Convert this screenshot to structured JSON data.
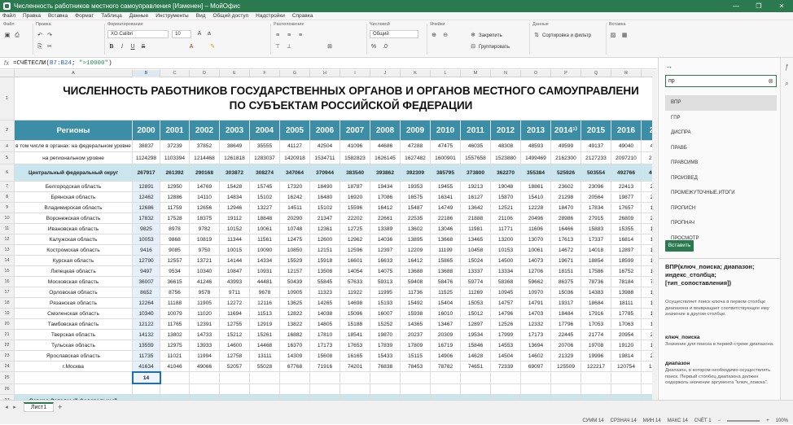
{
  "window": {
    "title": "Численность работников местного самоуправления [Изменен] – МойОфис",
    "controls": [
      "—",
      "❐",
      "✕"
    ]
  },
  "menu": [
    "Файл",
    "Правка",
    "Вставка",
    "Формат",
    "Таблица",
    "Данные",
    "Инструменты",
    "Вид",
    "Общий доступ",
    "Надстройки",
    "Справка"
  ],
  "ribbon": {
    "groups": [
      "Файл",
      "Правка",
      "Форматирование",
      "Расположение",
      "Числовой",
      "Ячейки",
      "Данные",
      "Вставка"
    ],
    "font_name": "XO Calibri",
    "font_size": "10",
    "number_format": "Общий",
    "freeze_label": "Закрепить",
    "group_label": "Группировать",
    "sort_label": "Сортировка и фильтр"
  },
  "formula_bar": {
    "fx": "fx",
    "prefix": "=СЧЁТЕСЛИ(",
    "range": "B7:B24",
    "sep": "; ",
    "criterion": "\">10000\"",
    "suffix": ")"
  },
  "columns": [
    "A",
    "B",
    "C",
    "D",
    "E",
    "F",
    "G",
    "H",
    "I",
    "J",
    "K",
    "L",
    "M",
    "N",
    "O",
    "P",
    "Q",
    "R",
    "S",
    "T"
  ],
  "sheet_title": {
    "line1": "ЧИСЛЕННОСТЬ РАБОТНИКОВ ГОСУДАРСТВЕННЫХ ОРГАНОВ И ОРГАНОВ МЕСТНОГО САМОУПРАВЛЕНИ",
    "line2": "ПО СУБЪЕКТАМ РОССИЙСКОЙ ФЕДЕРАЦИИ"
  },
  "header_row": {
    "label": "Регионы",
    "years": [
      "2000",
      "2001",
      "2002",
      "2003",
      "2004",
      "2005",
      "2006",
      "2007",
      "2008",
      "2009",
      "2010",
      "2011",
      "2012",
      "2013",
      "2014¹⁾",
      "2015",
      "2016",
      "201"
    ]
  },
  "rows": [
    {
      "rn": "4",
      "label": "в том числе в органах:\nна федеральном уровне",
      "vals": [
        "38837",
        "37239",
        "37852",
        "38649",
        "35555",
        "41127",
        "42504",
        "41096",
        "44686",
        "47288",
        "47475",
        "46035",
        "48308",
        "48593",
        "49599",
        "49137",
        "49040",
        "4967"
      ]
    },
    {
      "rn": "5",
      "label": "на региональном уровне",
      "vals": [
        "1124298",
        "1103394",
        "1214468",
        "1261818",
        "1283037",
        "1420918",
        "1534711",
        "1582823",
        "1626145",
        "1627482",
        "1600901",
        "1557658",
        "1523880",
        "1499469",
        "2162300",
        "2127233",
        "2097210",
        "21233"
      ]
    },
    {
      "rn": "6",
      "label": "Центральный федеральный округ",
      "fed": true,
      "vals": [
        "267917",
        "261392",
        "290168",
        "303872",
        "308274",
        "347064",
        "370944",
        "383540",
        "393862",
        "392309",
        "385795",
        "373800",
        "362270",
        "355384",
        "525926",
        "503554",
        "492766",
        "49153"
      ]
    },
    {
      "rn": "7",
      "label": "Белгородская область",
      "vals": [
        "12891",
        "12950",
        "14769",
        "15428",
        "15745",
        "17320",
        "18490",
        "18787",
        "19434",
        "19353",
        "19455",
        "19213",
        "19048",
        "18861",
        "23602",
        "23096",
        "22413",
        "2223"
      ]
    },
    {
      "rn": "8",
      "label": "Брянская область",
      "vals": [
        "12462",
        "12886",
        "14110",
        "14834",
        "15102",
        "16242",
        "16480",
        "16920",
        "17086",
        "16575",
        "16341",
        "16127",
        "15870",
        "15410",
        "21298",
        "20564",
        "19877",
        "2033"
      ]
    },
    {
      "rn": "9",
      "label": "Владимирская область",
      "vals": [
        "12686",
        "11759",
        "12656",
        "12946",
        "13227",
        "14511",
        "15102",
        "15596",
        "16412",
        "15487",
        "14749",
        "13642",
        "12521",
        "12228",
        "18470",
        "17834",
        "17657",
        "1786"
      ]
    },
    {
      "rn": "10",
      "label": "Воронежская область",
      "vals": [
        "17832",
        "17528",
        "18375",
        "19112",
        "18848",
        "20290",
        "21347",
        "22202",
        "22661",
        "22535",
        "22186",
        "21888",
        "21106",
        "20496",
        "28986",
        "27915",
        "26809",
        "2714"
      ]
    },
    {
      "rn": "11",
      "label": "Ивановская область",
      "vals": [
        "9825",
        "8978",
        "9782",
        "10152",
        "10061",
        "10748",
        "12361",
        "12725",
        "13389",
        "13602",
        "13046",
        "11981",
        "11771",
        "11606",
        "16466",
        "15883",
        "15355",
        "1525"
      ]
    },
    {
      "rn": "12",
      "label": "Калужская область",
      "vals": [
        "10053",
        "9868",
        "10819",
        "11344",
        "11561",
        "12475",
        "12600",
        "12962",
        "14036",
        "13895",
        "13668",
        "13465",
        "13200",
        "13070",
        "17613",
        "17337",
        "16814",
        "1725"
      ]
    },
    {
      "rn": "13",
      "label": "Костромская область",
      "vals": [
        "9416",
        "9085",
        "9750",
        "10015",
        "10090",
        "10850",
        "12151",
        "12596",
        "12397",
        "12209",
        "11199",
        "10458",
        "10153",
        "10061",
        "14672",
        "14018",
        "12897",
        "1308"
      ]
    },
    {
      "rn": "14",
      "label": "Курская область",
      "vals": [
        "12790",
        "12557",
        "13721",
        "14144",
        "14334",
        "15529",
        "15918",
        "16601",
        "16633",
        "16412",
        "15865",
        "15024",
        "14500",
        "14073",
        "19671",
        "18854",
        "18599",
        "1850"
      ]
    },
    {
      "rn": "15",
      "label": "Липецкая область",
      "vals": [
        "9497",
        "9534",
        "10340",
        "10847",
        "10931",
        "12157",
        "13508",
        "14054",
        "14075",
        "13688",
        "13688",
        "13337",
        "13334",
        "12706",
        "18151",
        "17586",
        "16752",
        "1721"
      ]
    },
    {
      "rn": "16",
      "label": "Московская область",
      "vals": [
        "36007",
        "36615",
        "41246",
        "43993",
        "44481",
        "50439",
        "55845",
        "57633",
        "59313",
        "59408",
        "58476",
        "59774",
        "58368",
        "59662",
        "86375",
        "78736",
        "78184",
        "7754"
      ]
    },
    {
      "rn": "17",
      "label": "Орловская область",
      "vals": [
        "8652",
        "8756",
        "9578",
        "9711",
        "9678",
        "10905",
        "11323",
        "11922",
        "11995",
        "11736",
        "11525",
        "11269",
        "10945",
        "10970",
        "15036",
        "14383",
        "13988",
        "1394"
      ]
    },
    {
      "rn": "18",
      "label": "Рязанская область",
      "vals": [
        "12264",
        "11188",
        "11905",
        "12272",
        "12116",
        "13625",
        "14265",
        "14698",
        "15193",
        "15492",
        "15404",
        "15053",
        "14757",
        "14791",
        "19317",
        "18684",
        "18111",
        "1859"
      ]
    },
    {
      "rn": "19",
      "label": "Смоленская область",
      "vals": [
        "10340",
        "10079",
        "11020",
        "11694",
        "11513",
        "12822",
        "14038",
        "15096",
        "16007",
        "15938",
        "16010",
        "15012",
        "14796",
        "14703",
        "18484",
        "17916",
        "17785",
        "1730"
      ]
    },
    {
      "rn": "20",
      "label": "Тамбовская область",
      "vals": [
        "12122",
        "11765",
        "12391",
        "12755",
        "12919",
        "13822",
        "14805",
        "15188",
        "15252",
        "14365",
        "13467",
        "12897",
        "12526",
        "12332",
        "17796",
        "17053",
        "17063",
        "1706"
      ]
    },
    {
      "rn": "21",
      "label": "Тверская область",
      "vals": [
        "14132",
        "13802",
        "14733",
        "15212",
        "15261",
        "16882",
        "17810",
        "18541",
        "19870",
        "20237",
        "20309",
        "19534",
        "17999",
        "17173",
        "22445",
        "21774",
        "20954",
        "2061"
      ]
    },
    {
      "rn": "22",
      "label": "Тульская область",
      "vals": [
        "13559",
        "12975",
        "13933",
        "14600",
        "14468",
        "16370",
        "17173",
        "17653",
        "17839",
        "17809",
        "16719",
        "15846",
        "14553",
        "13694",
        "20706",
        "19708",
        "19120",
        "1952"
      ]
    },
    {
      "rn": "23",
      "label": "Ярославская область",
      "vals": [
        "11735",
        "11021",
        "11994",
        "12758",
        "13111",
        "14309",
        "15608",
        "16165",
        "15433",
        "15115",
        "14906",
        "14628",
        "14504",
        "14602",
        "21329",
        "19996",
        "19814",
        "2016"
      ]
    },
    {
      "rn": "24",
      "label": "г.Москва",
      "vals": [
        "41634",
        "41046",
        "49066",
        "52057",
        "55028",
        "67768",
        "71916",
        "74201",
        "76838",
        "78453",
        "78782",
        "74651",
        "72339",
        "69097",
        "125509",
        "122217",
        "120754",
        "12150"
      ]
    },
    {
      "rn": "25",
      "label": "",
      "vals": [
        "14",
        "",
        "",
        "",
        "",
        "",
        "",
        "",
        "",
        "",
        "",
        "",
        "",
        "",
        "",
        "",
        "",
        ""
      ]
    },
    {
      "rn": "26",
      "label": "",
      "vals": [
        "",
        "",
        "",
        "",
        "",
        "",
        "",
        "",
        "",
        "",
        "",
        "",
        "",
        "",
        "",
        "",
        "",
        ""
      ]
    },
    {
      "rn": "27",
      "label": "Северо-Западный федеральный",
      "fed": true,
      "vals": [
        "",
        "",
        "",
        "",
        "",
        "",
        "",
        "",
        "",
        "",
        "",
        "",
        "",
        "",
        "",
        "",
        "",
        ""
      ]
    }
  ],
  "sheet_tabs": {
    "active": "Лист1"
  },
  "status": {
    "sum": "СУММ 14",
    "avg": "СРЗНАЧ 14",
    "min": "МИН 14",
    "max": "МАКС 14",
    "count": "СЧЁТ 1",
    "zoom": "100%"
  },
  "panel": {
    "query": "пр",
    "functions": [
      "ВПР",
      "ГПР",
      "ДИСПРА",
      "ПРАВБ",
      "ПРАВСИМВ",
      "ПРОИЗВЕД",
      "ПРОМЕЖУТОЧНЫЕ.ИТОГИ",
      "ПРОПИСН",
      "ПРОПНАЧ",
      "ПРОСМОТР"
    ],
    "insert_label": "Вставить",
    "signature": "ВПР(ключ_поиска; диапазон; индекс_столбца; [тип_сопоставления])",
    "description": "Осуществляет поиск ключа в первом столбце диапазона и возвращает соответствующее ему значение в другом столбце.",
    "arg1_name": "ключ_поиска",
    "arg1_desc": "Значение для поиска в первой строке диапазона.",
    "arg2_name": "диапазон",
    "arg2_desc": "Диапазон, в котором необходимо осуществлять поиск. Первый столбец диапазона должен содержать значение аргумента \"ключ_поиска\"."
  }
}
